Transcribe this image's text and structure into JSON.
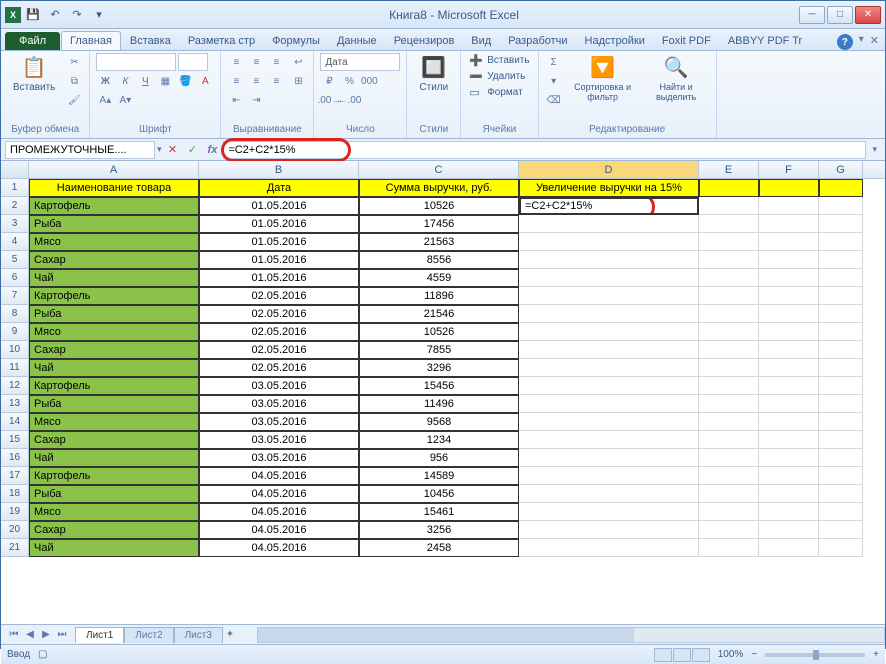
{
  "window": {
    "title": "Книга8 - Microsoft Excel"
  },
  "qat": {
    "save": "💾",
    "undo": "↶",
    "redo": "↷"
  },
  "tabs": {
    "file": "Файл",
    "items": [
      "Главная",
      "Вставка",
      "Разметка стр",
      "Формулы",
      "Данные",
      "Рецензиров",
      "Вид",
      "Разработчи",
      "Надстройки",
      "Foxit PDF",
      "ABBYY PDF Tr"
    ],
    "active_index": 0
  },
  "ribbon": {
    "clipboard": {
      "label": "Буфер обмена",
      "paste": "Вставить"
    },
    "font": {
      "label": "Шрифт"
    },
    "align": {
      "label": "Выравнивание"
    },
    "number": {
      "label": "Число",
      "format": "Дата"
    },
    "styles": {
      "label": "Стили",
      "btn": "Стили"
    },
    "cells": {
      "label": "Ячейки",
      "insert": "Вставить",
      "delete": "Удалить",
      "format": "Формат"
    },
    "editing": {
      "label": "Редактирование",
      "sort": "Сортировка и фильтр",
      "find": "Найти и выделить"
    }
  },
  "formula_bar": {
    "namebox": "ПРОМЕЖУТОЧНЫЕ....",
    "formula": "=C2+C2*15%"
  },
  "columns": [
    "A",
    "B",
    "C",
    "D",
    "E",
    "F",
    "G"
  ],
  "col_widths": {
    "A": 170,
    "B": 160,
    "C": 160,
    "D": 180,
    "E": 60,
    "F": 60,
    "G": 44
  },
  "headers": {
    "A": "Наименование товара",
    "B": "Дата",
    "C": "Сумма выручки, руб.",
    "D": "Увеличение выручки на 15%"
  },
  "active_cell": {
    "row": 2,
    "col": "D",
    "value": "=C2+C2*15%"
  },
  "rows": [
    {
      "n": 2,
      "A": "Картофель",
      "B": "01.05.2016",
      "C": "10526"
    },
    {
      "n": 3,
      "A": "Рыба",
      "B": "01.05.2016",
      "C": "17456"
    },
    {
      "n": 4,
      "A": "Мясо",
      "B": "01.05.2016",
      "C": "21563"
    },
    {
      "n": 5,
      "A": "Сахар",
      "B": "01.05.2016",
      "C": "8556"
    },
    {
      "n": 6,
      "A": "Чай",
      "B": "01.05.2016",
      "C": "4559"
    },
    {
      "n": 7,
      "A": "Картофель",
      "B": "02.05.2016",
      "C": "11896"
    },
    {
      "n": 8,
      "A": "Рыба",
      "B": "02.05.2016",
      "C": "21546"
    },
    {
      "n": 9,
      "A": "Мясо",
      "B": "02.05.2016",
      "C": "10526"
    },
    {
      "n": 10,
      "A": "Сахар",
      "B": "02.05.2016",
      "C": "7855"
    },
    {
      "n": 11,
      "A": "Чай",
      "B": "02.05.2016",
      "C": "3296"
    },
    {
      "n": 12,
      "A": "Картофель",
      "B": "03.05.2016",
      "C": "15456"
    },
    {
      "n": 13,
      "A": "Рыба",
      "B": "03.05.2016",
      "C": "11496"
    },
    {
      "n": 14,
      "A": "Мясо",
      "B": "03.05.2016",
      "C": "9568"
    },
    {
      "n": 15,
      "A": "Сахар",
      "B": "03.05.2016",
      "C": "1234"
    },
    {
      "n": 16,
      "A": "Чай",
      "B": "03.05.2016",
      "C": "956"
    },
    {
      "n": 17,
      "A": "Картофель",
      "B": "04.05.2016",
      "C": "14589"
    },
    {
      "n": 18,
      "A": "Рыба",
      "B": "04.05.2016",
      "C": "10456"
    },
    {
      "n": 19,
      "A": "Мясо",
      "B": "04.05.2016",
      "C": "15461"
    },
    {
      "n": 20,
      "A": "Сахар",
      "B": "04.05.2016",
      "C": "3256"
    },
    {
      "n": 21,
      "A": "Чай",
      "B": "04.05.2016",
      "C": "2458"
    }
  ],
  "sheets": {
    "items": [
      "Лист1",
      "Лист2",
      "Лист3"
    ],
    "active": 0
  },
  "status": {
    "mode": "Ввод",
    "zoom": "100%"
  }
}
